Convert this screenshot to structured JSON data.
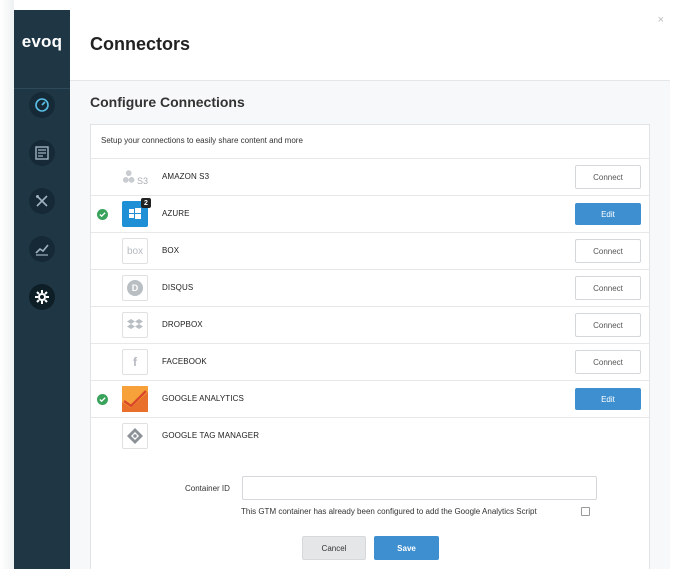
{
  "app": {
    "logo": "evoq"
  },
  "sidebar": {
    "items": [
      {
        "icon": "gauge-icon"
      },
      {
        "icon": "content-icon"
      },
      {
        "icon": "tools-icon"
      },
      {
        "icon": "analytics-icon"
      },
      {
        "icon": "gear-icon",
        "active": true
      }
    ]
  },
  "header": {
    "title": "Connectors",
    "close": "×"
  },
  "section": {
    "title": "Configure Connections",
    "intro": "Setup your connections to easily share content and more"
  },
  "connectors": [
    {
      "name": "AMAZON S3",
      "button": "Connect",
      "connected": false,
      "icon": "amazon-s3-icon",
      "logo_text": "S3"
    },
    {
      "name": "AZURE",
      "button": "Edit",
      "connected": true,
      "icon": "azure-icon",
      "badge": "2"
    },
    {
      "name": "BOX",
      "button": "Connect",
      "connected": false,
      "icon": "box-icon",
      "logo_text": "box"
    },
    {
      "name": "DISQUS",
      "button": "Connect",
      "connected": false,
      "icon": "disqus-icon",
      "logo_text": "D"
    },
    {
      "name": "DROPBOX",
      "button": "Connect",
      "connected": false,
      "icon": "dropbox-icon"
    },
    {
      "name": "FACEBOOK",
      "button": "Connect",
      "connected": false,
      "icon": "facebook-icon",
      "logo_text": "f"
    },
    {
      "name": "GOOGLE ANALYTICS",
      "button": "Edit",
      "connected": true,
      "icon": "google-analytics-icon"
    },
    {
      "name": "GOOGLE TAG MANAGER",
      "button": "",
      "connected": false,
      "icon": "google-tag-manager-icon"
    }
  ],
  "gtm_form": {
    "container_label": "Container ID",
    "container_value": "",
    "note": "This GTM container has already been configured to add the Google Analytics Script",
    "cancel": "Cancel",
    "save": "Save"
  },
  "colors": {
    "sidebar": "#1f3745",
    "primary": "#3d8fcf",
    "success": "#3aa35b"
  }
}
